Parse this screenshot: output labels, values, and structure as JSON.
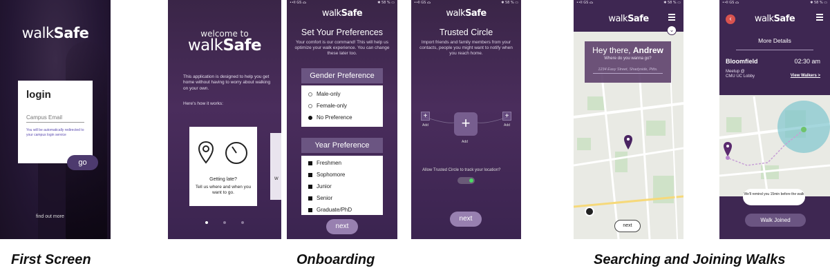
{
  "brand": {
    "light": "walk",
    "bold": "Safe"
  },
  "status": {
    "left": "••ll GS ᯅ",
    "right": "✱ 58 % ▭"
  },
  "captions": {
    "first": "First Screen",
    "onboarding": "Onboarding",
    "searching": "Searching and Joining Walks"
  },
  "login": {
    "title": "login",
    "email_placeholder": "Campus Email",
    "note": "You will be automatically redirected to your campus login service",
    "go": "go",
    "find_more": "find out more"
  },
  "welcome": {
    "line1": "welcome to",
    "desc": "This application is designed to help you get home without having to worry about walking on your own.",
    "how": "Here's how it works:",
    "card_title": "Getting late?",
    "card_text": "Tell us where and when you want to go.",
    "peek_text": "W"
  },
  "preferences": {
    "title": "Set Your Preferences",
    "subtitle": "Your comfort is our command! This will help us optimize your walk experience. You can change these later too.",
    "gender_head": "Gender Preference",
    "gender_options": [
      {
        "label": "Male-only",
        "selected": false
      },
      {
        "label": "Female-only",
        "selected": false
      },
      {
        "label": "No Preference",
        "selected": true
      }
    ],
    "year_head": "Year Preference",
    "year_options": [
      "Freshmen",
      "Sophomore",
      "Junior",
      "Senior",
      "Graduate/PhD"
    ],
    "next": "next"
  },
  "trusted": {
    "title": "Trusted Circle",
    "subtitle": "Import friends and family members from your contacts, people you might want to notify when you reach home.",
    "add": "Add",
    "allow": "Allow Trusted Circle to track your location?",
    "toggle_on": true,
    "next": "next"
  },
  "search": {
    "greeting_prefix": "Hey there,",
    "greeting_name": "Andrew",
    "question": "Where do you wanna go?",
    "address": "1234 Easy Street, Shadyside, Pitts.",
    "next": "next"
  },
  "details": {
    "title": "More Details",
    "location": "Bloomfield",
    "time": "02:30 am",
    "meetup_label": "Meetup @",
    "meetup_place": "CMU UC Lobby",
    "view_walkers": "View Walkers >",
    "remind": "We'll remind you 15min before the walk",
    "joined": "Walk Joined",
    "back_icon": "‹"
  },
  "colors": {
    "purple": "#3e2752",
    "accent": "#9880b0",
    "map": "#e9eae4",
    "pin": "#5a2a6e",
    "circle": "#7fc6cf",
    "green": "#4cd964"
  }
}
